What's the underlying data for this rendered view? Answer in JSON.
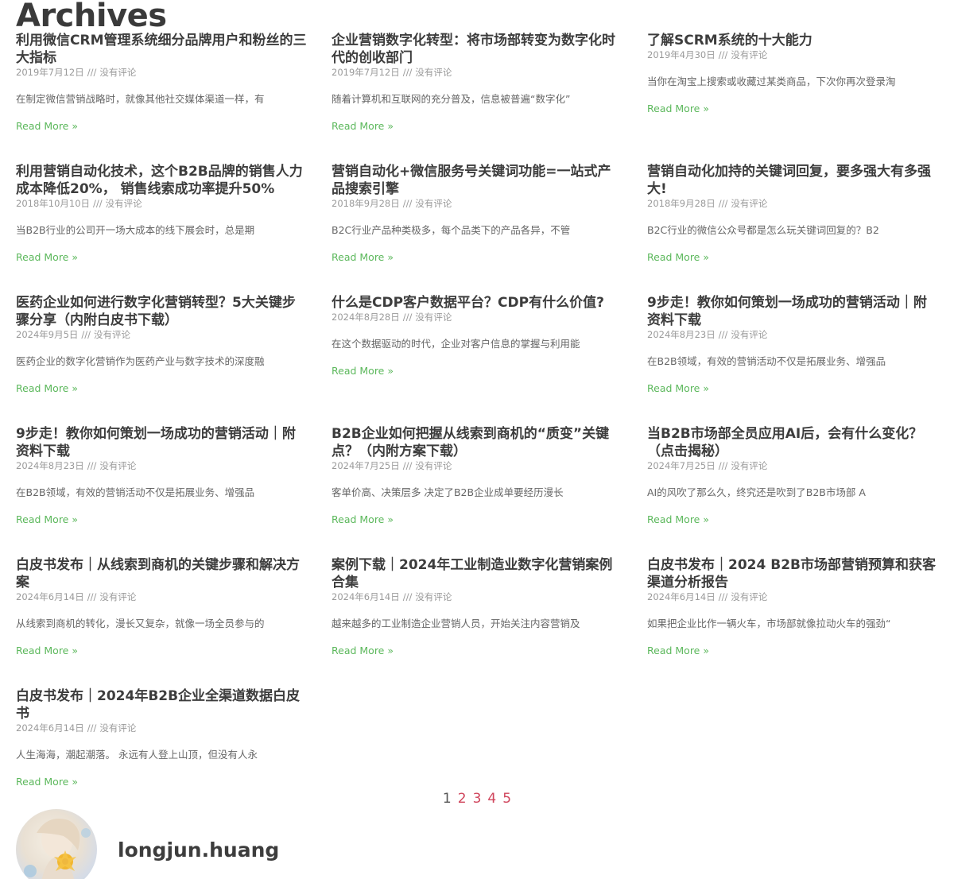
{
  "page": {
    "title": "Archives"
  },
  "posts": [
    {
      "title": "利用微信CRM管理系统细分品牌用户和粉丝的三大指标",
      "date": "2019年7月12日",
      "separator": "///",
      "comments": "没有评论",
      "excerpt": "在制定微信营销战略时，就像其他社交媒体渠道一样，有",
      "read_more": "Read More »"
    },
    {
      "title": "企业营销数字化转型：将市场部转变为数字化时代的创收部门",
      "date": "2019年7月12日",
      "separator": "///",
      "comments": "没有评论",
      "excerpt": "随着计算机和互联网的充分普及，信息被普遍“数字化”",
      "read_more": "Read More »"
    },
    {
      "title": "了解SCRM系统的十大能力",
      "date": "2019年4月30日",
      "separator": "///",
      "comments": "没有评论",
      "excerpt": "当你在淘宝上搜索或收藏过某类商品，下次你再次登录淘",
      "read_more": "Read More »"
    },
    {
      "title": "利用营销自动化技术，这个B2B品牌的销售人力成本降低20%， 销售线索成功率提升50%",
      "date": "2018年10月10日",
      "separator": "///",
      "comments": "没有评论",
      "excerpt": "当B2B行业的公司开一场大成本的线下展会时，总是期",
      "read_more": "Read More »"
    },
    {
      "title": "营销自动化+微信服务号关键词功能=一站式产品搜索引擎",
      "date": "2018年9月28日",
      "separator": "///",
      "comments": "没有评论",
      "excerpt": "B2C行业产品种类极多，每个品类下的产品各异，不管",
      "read_more": "Read More »"
    },
    {
      "title": "营销自动化加持的关键词回复，要多强大有多强大!",
      "date": "2018年9月28日",
      "separator": "///",
      "comments": "没有评论",
      "excerpt": "B2C行业的微信公众号都是怎么玩关键词回复的？B2",
      "read_more": "Read More »"
    },
    {
      "title": "医药企业如何进行数字化营销转型？5大关键步骤分享（内附白皮书下载）",
      "date": "2024年9月5日",
      "separator": "///",
      "comments": "没有评论",
      "excerpt": "医药企业的数字化营销作为医药产业与数字技术的深度融",
      "read_more": "Read More »"
    },
    {
      "title": "什么是CDP客户数据平台？CDP有什么价值?",
      "date": "2024年8月28日",
      "separator": "///",
      "comments": "没有评论",
      "excerpt": "在这个数据驱动的时代，企业对客户信息的掌握与利用能",
      "read_more": "Read More »"
    },
    {
      "title": "9步走！教你如何策划一场成功的营销活动｜附资料下载",
      "date": "2024年8月23日",
      "separator": "///",
      "comments": "没有评论",
      "excerpt": "在B2B领域，有效的营销活动不仅是拓展业务、增强品",
      "read_more": "Read More »"
    },
    {
      "title": "9步走！教你如何策划一场成功的营销活动｜附资料下载",
      "date": "2024年8月23日",
      "separator": "///",
      "comments": "没有评论",
      "excerpt": "在B2B领域，有效的营销活动不仅是拓展业务、增强品",
      "read_more": "Read More »"
    },
    {
      "title": "B2B企业如何把握从线索到商机的“质变”关键点？（内附方案下载）",
      "date": "2024年7月25日",
      "separator": "///",
      "comments": "没有评论",
      "excerpt": "客单价高、决策层多 决定了B2B企业成单要经历漫长",
      "read_more": "Read More »"
    },
    {
      "title": "当B2B市场部全员应用AI后，会有什么变化？（点击揭秘）",
      "date": "2024年7月25日",
      "separator": "///",
      "comments": "没有评论",
      "excerpt": "AI的风吹了那么久，终究还是吹到了B2B市场部 A",
      "read_more": "Read More »"
    },
    {
      "title": "白皮书发布｜从线索到商机的关键步骤和解决方案",
      "date": "2024年6月14日",
      "separator": "///",
      "comments": "没有评论",
      "excerpt": "从线索到商机的转化，漫长又复杂，就像一场全员参与的",
      "read_more": "Read More »"
    },
    {
      "title": "案例下载｜2024年工业制造业数字化营销案例合集",
      "date": "2024年6月14日",
      "separator": "///",
      "comments": "没有评论",
      "excerpt": "越来越多的工业制造企业营销人员，开始关注内容营销及",
      "read_more": "Read More »"
    },
    {
      "title": "白皮书发布｜2024 B2B市场部营销预算和获客渠道分析报告",
      "date": "2024年6月14日",
      "separator": "///",
      "comments": "没有评论",
      "excerpt": "如果把企业比作一辆火车，市场部就像拉动火车的强劲“",
      "read_more": "Read More »"
    },
    {
      "title": "白皮书发布｜2024年B2B企业全渠道数据白皮书",
      "date": "2024年6月14日",
      "separator": "///",
      "comments": "没有评论",
      "excerpt": "人生海海，潮起潮落。 永远有人登上山顶，但没有人永",
      "read_more": "Read More »"
    }
  ],
  "pagination": {
    "pages": [
      "1",
      "2",
      "3",
      "4",
      "5"
    ],
    "current": "1",
    "link_color": "#d0455c"
  },
  "author": {
    "name": "longjun.huang",
    "avatar_icon": "avatar-illustration"
  },
  "colors": {
    "read_more": "#5cb85c",
    "title": "#3d3d3d",
    "meta": "#9a9a9a"
  }
}
